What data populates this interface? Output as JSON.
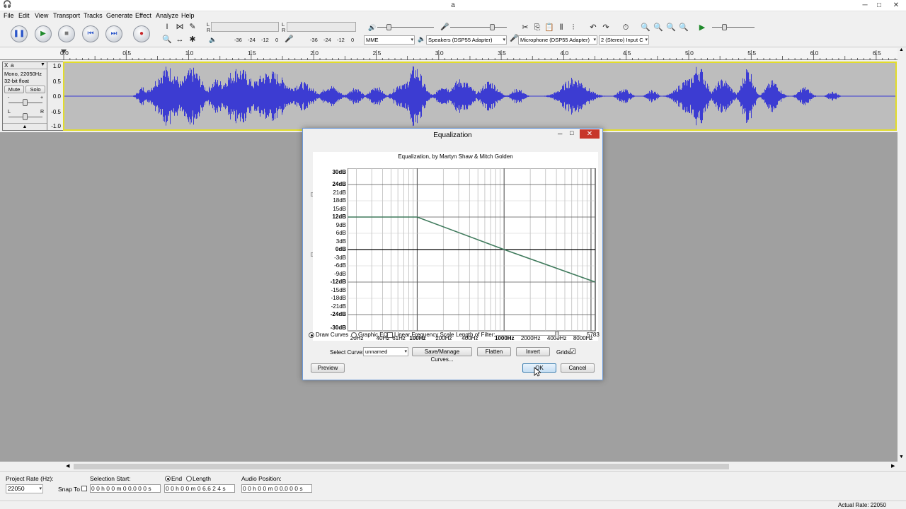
{
  "window": {
    "title": "a",
    "minimize": "─",
    "maximize": "□",
    "close": "✕"
  },
  "menu": [
    "File",
    "Edit",
    "View",
    "Transport",
    "Tracks",
    "Generate",
    "Effect",
    "Analyze",
    "Help"
  ],
  "toolbar": {
    "pause": "❚❚",
    "play": "▶",
    "stop": "■",
    "skip_start": "⏮",
    "skip_end": "⏭",
    "record": "●",
    "meter_ticks_left": [
      "-36",
      "-24",
      "-12",
      "0"
    ],
    "meter_ticks_right": [
      "-36",
      "-24",
      "-12",
      "0"
    ],
    "meter_l": "L",
    "meter_r": "R",
    "host": "MME",
    "output_device": "Speakers (DSP55 Adapter)",
    "input_device": "Microphone (DSP55 Adapter)",
    "channels": "2 (Stereo) Input C"
  },
  "ruler": [
    "0.0",
    "0.5",
    "1.0",
    "1.5",
    "2.0",
    "2.5",
    "3.0",
    "3.5",
    "4.0",
    "4.5",
    "5.0",
    "5.5",
    "6.0",
    "6.5"
  ],
  "track": {
    "close": "X",
    "name": "a",
    "info1": "Mono, 22050Hz",
    "info2": "32-bit float",
    "mute": "Mute",
    "solo": "Solo",
    "gain_minus": "-",
    "gain_plus": "+",
    "pan_l": "L",
    "pan_r": "R",
    "collapse": "▲",
    "vruler": [
      "1.0",
      "0.5",
      "0.0",
      "-0.5",
      "-1.0"
    ],
    "color": "#3c3cd2"
  },
  "dialog": {
    "title": "Equalization",
    "caption": "Equalization, by Martyn Shaw & Mitch Golden",
    "db_labels": [
      {
        "t": "30dB",
        "b": true
      },
      {
        "t": "24dB",
        "b": true
      },
      {
        "t": "21dB",
        "b": false
      },
      {
        "t": "18dB",
        "b": false
      },
      {
        "t": "15dB",
        "b": false
      },
      {
        "t": "12dB",
        "b": true
      },
      {
        "t": "9dB",
        "b": false
      },
      {
        "t": "6dB",
        "b": false
      },
      {
        "t": "3dB",
        "b": false
      },
      {
        "t": "0dB",
        "b": true
      },
      {
        "t": "-3dB",
        "b": false
      },
      {
        "t": "-6dB",
        "b": false
      },
      {
        "t": "-9dB",
        "b": false
      },
      {
        "t": "-12dB",
        "b": true
      },
      {
        "t": "-15dB",
        "b": false
      },
      {
        "t": "-18dB",
        "b": false
      },
      {
        "t": "-21dB",
        "b": false
      },
      {
        "t": "-24dB",
        "b": true
      },
      {
        "t": "-30dB",
        "b": true
      }
    ],
    "hz_labels": [
      {
        "t": "20Hz",
        "b": false
      },
      {
        "t": "40Hz",
        "b": false
      },
      {
        "t": "61Hz",
        "b": false
      },
      {
        "t": "100Hz",
        "b": true
      },
      {
        "t": "200Hz",
        "b": false
      },
      {
        "t": "400Hz",
        "b": false
      },
      {
        "t": "1000Hz",
        "b": true
      },
      {
        "t": "2000Hz",
        "b": false
      },
      {
        "t": "4000Hz",
        "b": false
      },
      {
        "t": "8000Hz",
        "b": false
      }
    ],
    "curve_color": "#3f7a5c",
    "draw_curves": "Draw Curves",
    "graphic_eq": "Graphic EQ",
    "linear_freq": "Linear Frequency Scale",
    "length_label": "Length of Filter:",
    "length_value": "5783",
    "select_curve_label": "Select Curve:",
    "select_curve_value": "unnamed",
    "save_manage": "Save/Manage Curves...",
    "flatten": "Flatten",
    "invert": "Invert",
    "grids": "Grids",
    "grids_check": "✓",
    "preview": "Preview",
    "ok": "OK",
    "cancel": "Cancel"
  },
  "selection_bar": {
    "project_rate_label": "Project Rate (Hz):",
    "project_rate": "22050",
    "snap_to": "Snap To",
    "selection_start_label": "Selection Start:",
    "selection_start": "0 0 h 0 0 m 0 0.0 0 0 s",
    "end_label": "End",
    "length_label": "Length",
    "end_value": "0 0 h 0 0 m 0 6.6 2 4 s",
    "audio_position_label": "Audio Position:",
    "audio_position": "0 0 h 0 0 m 0 0.0 0 0 s"
  },
  "status": {
    "actual_rate": "Actual Rate: 22050"
  }
}
